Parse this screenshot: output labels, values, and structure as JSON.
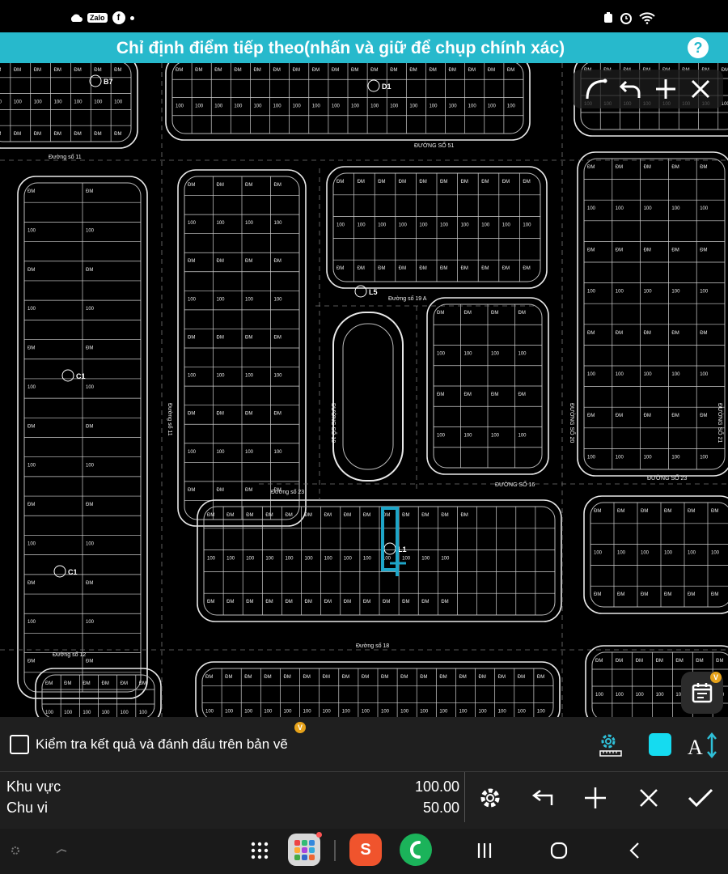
{
  "status": {
    "left_icons": [
      "cloud-icon",
      "zalo-icon",
      "facebook-icon",
      "notification-dot"
    ],
    "zalo_label": "Zalo",
    "facebook_label": "f",
    "right_icons": [
      "app-icon",
      "alarm-icon",
      "wifi-icon"
    ]
  },
  "header": {
    "title": "Chỉ định điểm tiếp theo(nhấn và giữ để chụp chính xác)",
    "help_label": "?",
    "accent": "#27b9cc"
  },
  "map": {
    "labels": {
      "b7": "B7",
      "d1": "D1",
      "c1": "C1",
      "c1b": "C1",
      "st51": "ĐƯỜNG SỐ 51",
      "st11": "Đường số 11",
      "st12": "Đường số 12",
      "st19a": "Đường số 19 A",
      "st23": "Đường số 23",
      "st23b": "ĐƯỜNG SỐ 23",
      "st18": "Đường số 18",
      "st19": "ĐƯỜNG SỐ 19",
      "st16": "ĐƯỜNG SỐ 16",
      "st20": "ĐƯỜNG SỐ 20",
      "st21": "ĐƯỜNG SỐ 21",
      "st_md": "Đường số 11",
      "l1": "L1",
      "l5": "L5",
      "lot_dm": "ĐM",
      "lot_num": "100"
    },
    "highlight_color": "#1ea5c8"
  },
  "draw_tools": {
    "items": [
      "arc-icon",
      "undo-icon",
      "add-icon",
      "close-icon"
    ]
  },
  "calendar": {
    "badge": "V"
  },
  "check": {
    "label": "Kiểm tra kết quả và đánh dấu trên bản vẽ",
    "badge": "V",
    "color_swatch": "#15dbf0",
    "text_icon": "A"
  },
  "results": {
    "area_label": "Khu vực",
    "area_value": "100.00",
    "perimeter_label": "Chu vi",
    "perimeter_value": "50.00"
  },
  "actions": [
    "settings-icon",
    "back-arrow-icon",
    "add-icon",
    "close-icon",
    "check-icon"
  ],
  "nav": {
    "items": [
      "app-drawer-icon",
      "folder-icon",
      "shopee-icon",
      "phone-icon",
      "recents-icon",
      "home-icon",
      "back-icon"
    ],
    "shopee_label": "S"
  }
}
